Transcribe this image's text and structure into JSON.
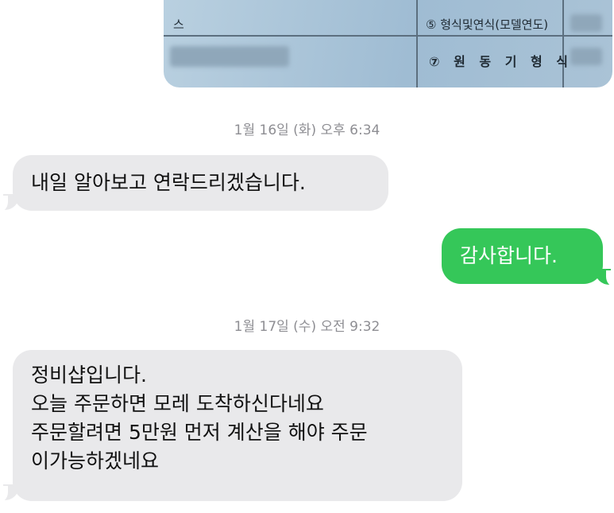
{
  "image_attachment": {
    "doc_labels": {
      "row1_left": "스",
      "row1_right": "⑤ 형식및연식(모델연도)",
      "row2_right": "⑦ 원 동 기 형 식"
    }
  },
  "messages": [
    {
      "type": "timestamp",
      "text": "1월 16일 (화) 오후 6:34"
    },
    {
      "type": "incoming",
      "lines": [
        "내일 알아보고 연락드리겠습니다."
      ]
    },
    {
      "type": "outgoing",
      "lines": [
        "감사합니다."
      ]
    },
    {
      "type": "timestamp",
      "text": "1월 17일 (수) 오전 9:32"
    },
    {
      "type": "incoming",
      "lines": [
        "정비샵입니다.",
        "오늘 주문하면 모레 도착하신다네요",
        "주문할려면 5만원 먼저 계산을 해야 주문",
        "이가능하겠네요"
      ]
    }
  ],
  "colors": {
    "incoming_bubble": "#e9e9eb",
    "outgoing_bubble": "#35c759",
    "timestamp_text": "#8e8e93"
  }
}
